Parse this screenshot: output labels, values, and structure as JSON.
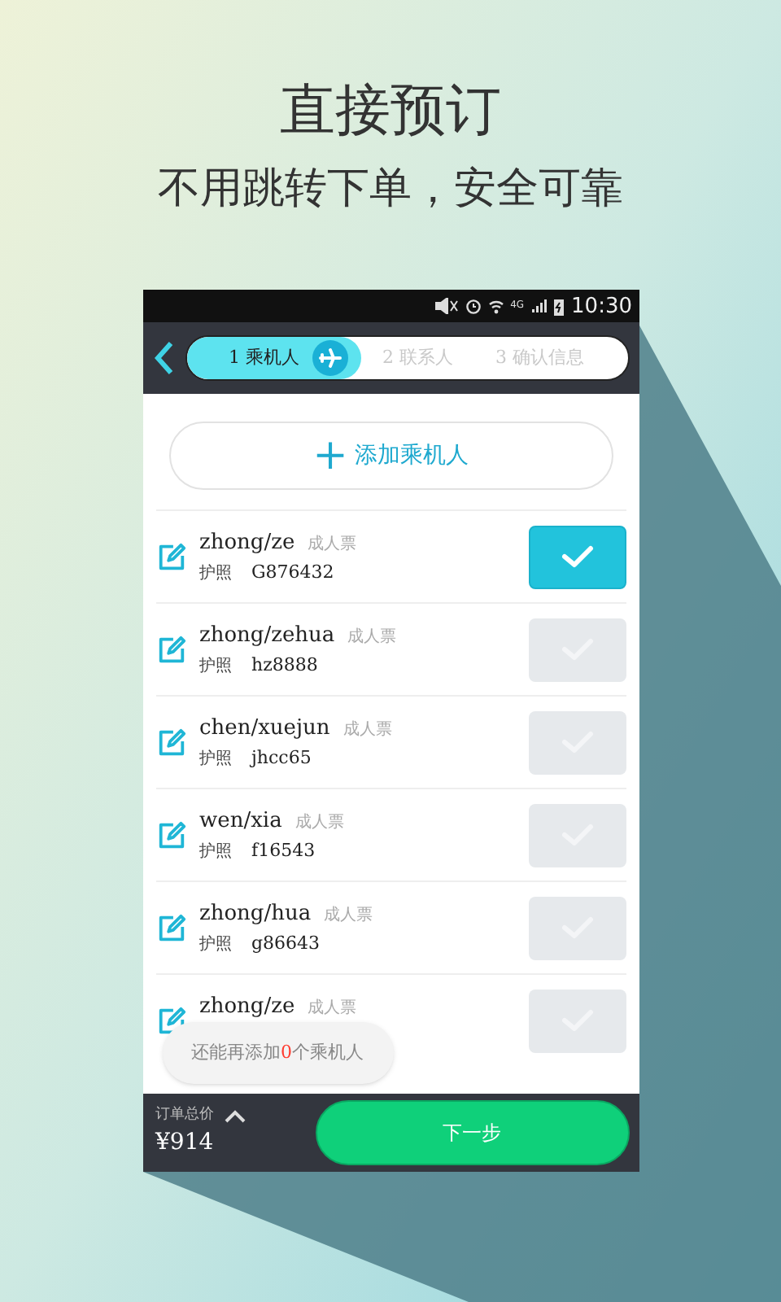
{
  "headline": "直接预订",
  "subheadline": "不用跳转下单，安全可靠",
  "status_bar": {
    "time": "10:30",
    "network": "4G"
  },
  "steps": [
    {
      "label": "1 乘机人",
      "selected": true
    },
    {
      "label": "2 联系人",
      "selected": false
    },
    {
      "label": "3 确认信息",
      "selected": false
    }
  ],
  "add_button": {
    "icon": "+",
    "label": "添加乘机人"
  },
  "passengers": [
    {
      "name": "zhong/ze",
      "type": "成人票",
      "id_type": "护照",
      "id_number": "G876432",
      "selected": true
    },
    {
      "name": "zhong/zehua",
      "type": "成人票",
      "id_type": "护照",
      "id_number": "hz8888",
      "selected": false
    },
    {
      "name": "chen/xuejun",
      "type": "成人票",
      "id_type": "护照",
      "id_number": "jhcc65",
      "selected": false
    },
    {
      "name": "wen/xia",
      "type": "成人票",
      "id_type": "护照",
      "id_number": "f16543",
      "selected": false
    },
    {
      "name": "zhong/hua",
      "type": "成人票",
      "id_type": "护照",
      "id_number": "g86643",
      "selected": false
    },
    {
      "name": "zhong/ze",
      "type": "成人票",
      "selected": false
    }
  ],
  "tooltip": {
    "prefix": "还能再添加",
    "count": "0",
    "suffix": "个乘机人"
  },
  "footer": {
    "total_label": "订单总价",
    "total": "¥914",
    "next_button": "下一步"
  }
}
